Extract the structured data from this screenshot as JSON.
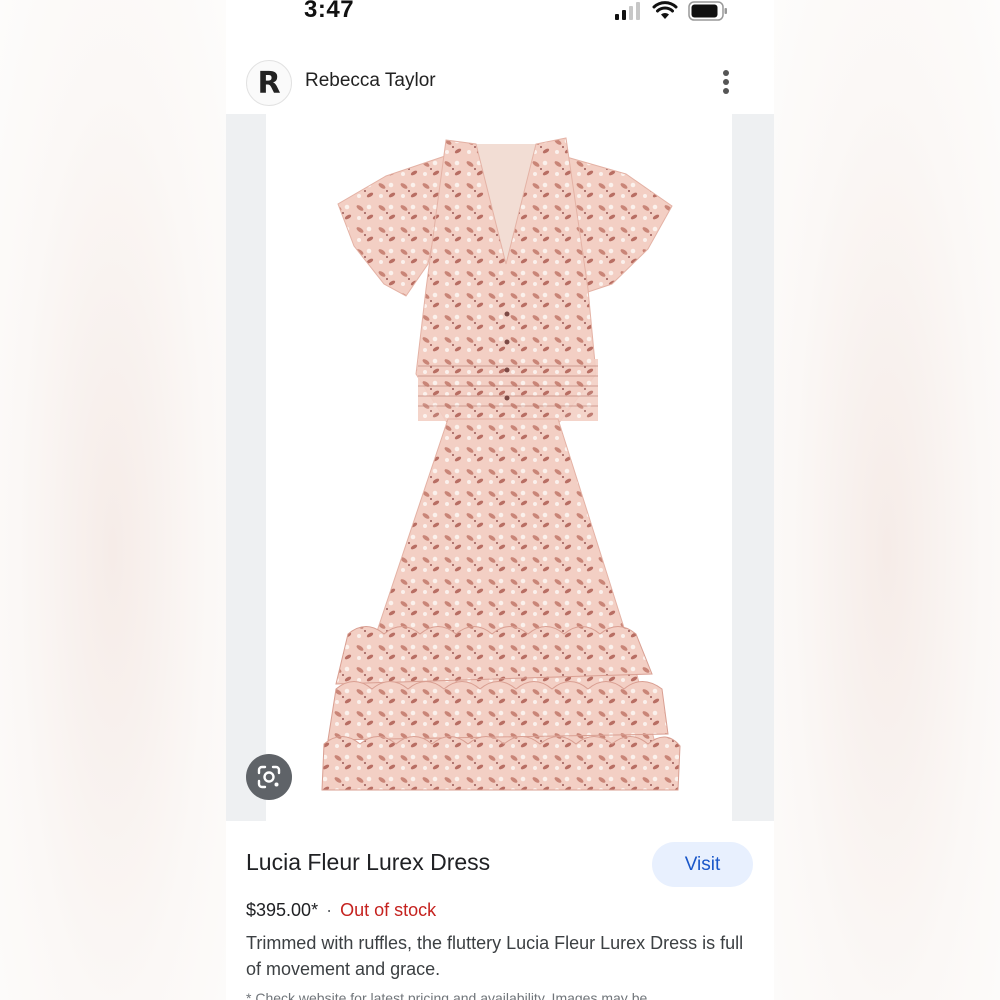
{
  "status_bar": {
    "time": "3:47"
  },
  "header": {
    "avatar_letter": "R",
    "brand_name": "Rebecca Taylor"
  },
  "product": {
    "title": "Lucia Fleur Lurex Dress",
    "visit_label": "Visit",
    "price": "$395.00*",
    "separator": "·",
    "stock_status": "Out of stock",
    "description": "Trimmed with ruffles, the fluttery Lucia Fleur Lurex Dress is full of movement and grace.",
    "disclaimer": "* Check website for latest pricing and availability. Images may be"
  },
  "colors": {
    "accent": "#1a57c9",
    "visit_bg": "#e8f0fe",
    "out_of_stock": "#c5221f",
    "dress_base": "#f0c8bc",
    "dress_print": "#c98577"
  },
  "icons": [
    "cellular-signal-icon",
    "wifi-icon",
    "battery-icon",
    "more-vert-icon",
    "google-lens-icon"
  ]
}
